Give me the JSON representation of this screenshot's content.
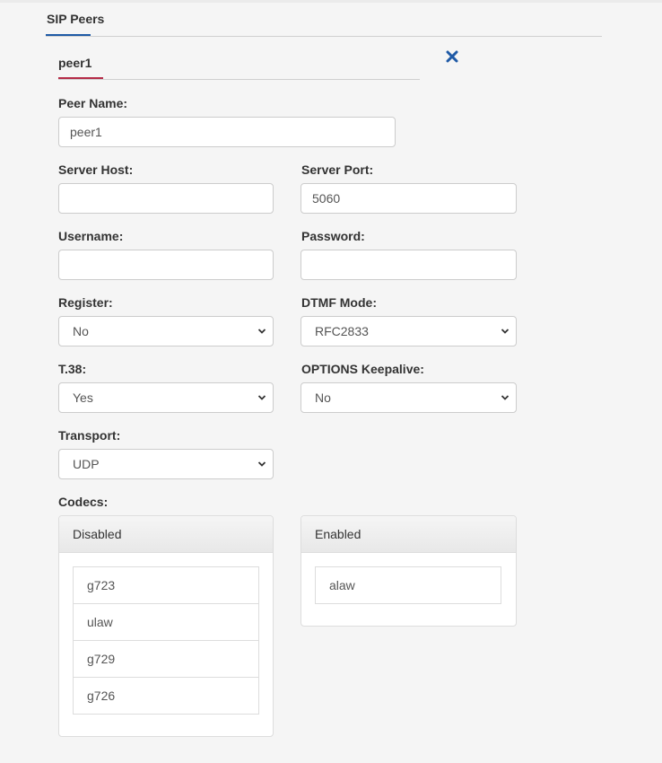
{
  "section": {
    "tab_label": "SIP Peers"
  },
  "peer": {
    "tab_label": "peer1",
    "close_icon": "close-x-icon",
    "close_color": "#1f5aa6"
  },
  "accent": {
    "blue": "#1f5aa6",
    "red": "#b52b47"
  },
  "form": {
    "peer_name": {
      "label": "Peer Name:",
      "value": "peer1"
    },
    "server_host": {
      "label": "Server Host:",
      "value": ""
    },
    "server_port": {
      "label": "Server Port:",
      "value": "5060"
    },
    "username": {
      "label": "Username:",
      "value": ""
    },
    "password": {
      "label": "Password:",
      "value": ""
    },
    "register": {
      "label": "Register:",
      "selected": "No"
    },
    "dtmf_mode": {
      "label": "DTMF Mode:",
      "selected": "RFC2833"
    },
    "t38": {
      "label": "T.38:",
      "selected": "Yes"
    },
    "options_keepalive": {
      "label": "OPTIONS Keepalive:",
      "selected": "No"
    },
    "transport": {
      "label": "Transport:",
      "selected": "UDP"
    },
    "codecs": {
      "label": "Codecs:",
      "disabled": {
        "title": "Disabled",
        "items": [
          "g723",
          "ulaw",
          "g729",
          "g726"
        ]
      },
      "enabled": {
        "title": "Enabled",
        "items": [
          "alaw"
        ]
      }
    }
  }
}
